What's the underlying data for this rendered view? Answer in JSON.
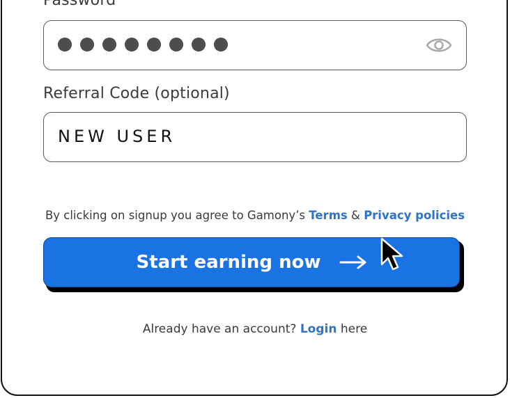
{
  "password": {
    "label": "Password",
    "masked_length": 8,
    "toggle_icon": "eye-icon"
  },
  "referral": {
    "label": "Referral Code (optional)",
    "value": "NEW USER"
  },
  "agreement": {
    "prefix": "By clicking on signup you agree to Gamony’s",
    "terms_link": "Terms",
    "ampersand": "&",
    "privacy_link": "Privacy policies"
  },
  "submit": {
    "label": "Start earning now",
    "icon": "arrow-right-icon"
  },
  "login": {
    "prefix": "Already have an account?",
    "link": "Login",
    "suffix": "here"
  },
  "colors": {
    "primary": "#1a73e2",
    "link": "#2f72c9",
    "border": "#111111",
    "text": "#3a3a3a"
  }
}
